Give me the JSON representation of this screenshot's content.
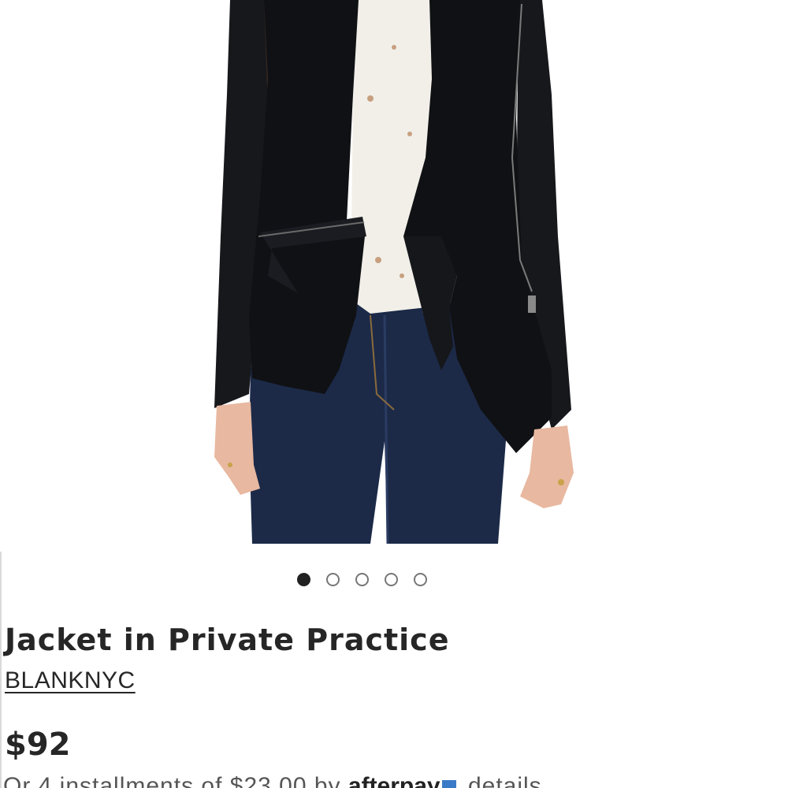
{
  "product": {
    "image_alt": "Model wearing black draped jacket with leather sleeves, white distressed tee and dark denim jeans",
    "title": "Jacket in Private Practice",
    "brand": "BLANKNYC",
    "price": "$92"
  },
  "gallery": {
    "total_images": 5,
    "active_index": 1
  },
  "installments": {
    "prefix": "Or 4 installments of $23.00 by",
    "provider": "afterpay",
    "details_label": "details"
  },
  "colors": {
    "text": "#262626",
    "dot_active": "#222222",
    "dot_inactive": "#777777",
    "jacket": "#101114",
    "denim": "#1c2a48",
    "skin": "#e8b8a0"
  }
}
